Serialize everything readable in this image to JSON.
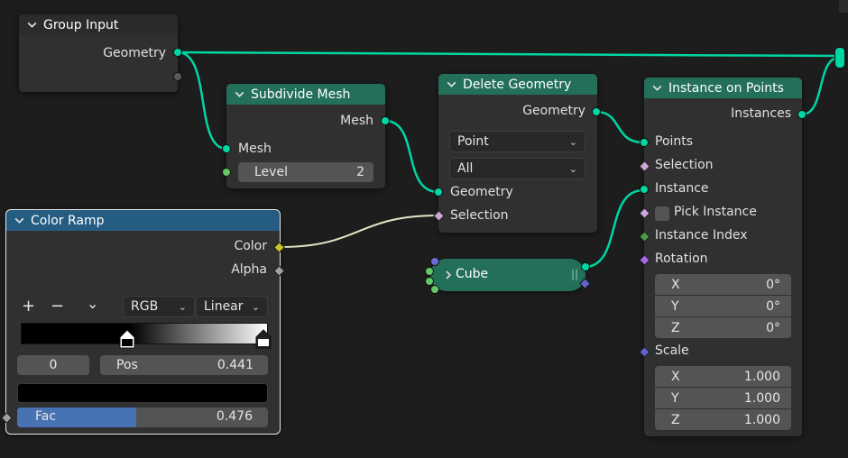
{
  "group_input": {
    "title": "Group Input",
    "geometry": "Geometry"
  },
  "subdivide_mesh": {
    "title": "Subdivide Mesh",
    "out_mesh": "Mesh",
    "in_mesh": "Mesh",
    "level_label": "Level",
    "level_value": "2"
  },
  "delete_geometry": {
    "title": "Delete Geometry",
    "out_geometry": "Geometry",
    "domain": "Point",
    "mode": "All",
    "in_geometry": "Geometry",
    "selection": "Selection"
  },
  "instance_on_points": {
    "title": "Instance on Points",
    "out_instances": "Instances",
    "points": "Points",
    "selection": "Selection",
    "instance": "Instance",
    "pick_instance": "Pick Instance",
    "instance_index": "Instance Index",
    "rotation": "Rotation",
    "rotation_values": [
      {
        "axis": "X",
        "value": "0°"
      },
      {
        "axis": "Y",
        "value": "0°"
      },
      {
        "axis": "Z",
        "value": "0°"
      }
    ],
    "scale": "Scale",
    "scale_values": [
      {
        "axis": "X",
        "value": "1.000"
      },
      {
        "axis": "Y",
        "value": "1.000"
      },
      {
        "axis": "Z",
        "value": "1.000"
      }
    ]
  },
  "cube": {
    "title": "Cube"
  },
  "color_ramp": {
    "title": "Color Ramp",
    "color": "Color",
    "alpha": "Alpha",
    "add": "+",
    "remove": "−",
    "menu": "⌄",
    "color_mode": "RGB",
    "interpolation": "Linear",
    "stop_index": "0",
    "pos_label": "Pos",
    "pos_value": "0.441",
    "fac_label": "Fac",
    "fac_value": "0.476",
    "fac_fraction": 0.476
  },
  "colors": {
    "geometry_socket": "#00d6a3",
    "float_socket": "#a1a1a1",
    "color_socket": "#c7c729",
    "vector_socket": "#6363c7",
    "rotation_socket": "#a06be0",
    "bool_socket": "#cca6d6",
    "int_socket": "#4c9a4c"
  }
}
